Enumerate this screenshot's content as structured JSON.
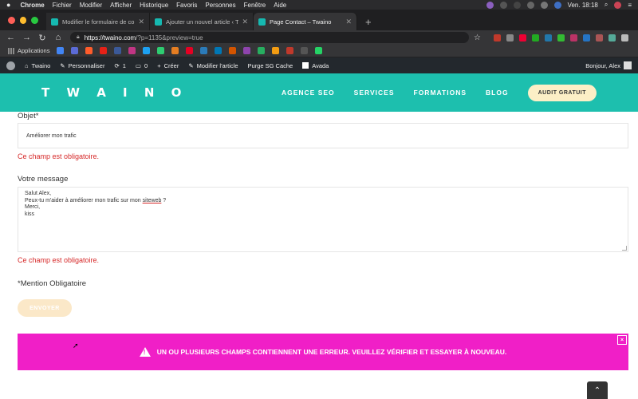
{
  "menubar": {
    "app": "Chrome",
    "menus": [
      "Fichier",
      "Modifier",
      "Afficher",
      "Historique",
      "Favoris",
      "Personnes",
      "Fenêtre",
      "Aide"
    ],
    "datetime": "Ven. 18:18"
  },
  "tabs": [
    {
      "title": "Modifier le formulaire de conta"
    },
    {
      "title": "Ajouter un nouvel article ‹ Twa"
    },
    {
      "title": "Page Contact – Twaino"
    }
  ],
  "address": {
    "host": "https://twaino.com",
    "path": "/?p=1135&preview=true"
  },
  "bookmarks": {
    "apps_label": "Applications"
  },
  "wpbar": {
    "site": "Twaino",
    "customize": "Personnaliser",
    "updates": "1",
    "comments": "0",
    "new": "Créer",
    "edit": "Modifier l'article",
    "purge": "Purge SG Cache",
    "avada": "Avada",
    "greeting": "Bonjour, Alex"
  },
  "header": {
    "logo": "T W A I N O",
    "nav": [
      "AGENCE SEO",
      "SERVICES",
      "FORMATIONS",
      "BLOG"
    ],
    "cta": "AUDIT GRATUIT"
  },
  "form": {
    "subject_label": "Objet*",
    "subject_value": "Améliorer mon trafic",
    "subject_error": "Ce champ est obligatoire.",
    "message_label": "Votre message",
    "message_lines": {
      "l1": "Salut Alex,",
      "l2a": "Peux-tu m'aider à améliorer mon trafic sur mon ",
      "l2b": "siteweb",
      "l2c": " ?",
      "l3": "Merci,",
      "l4": "kiss"
    },
    "message_error": "Ce champ est obligatoire.",
    "mandatory_note": "*Mention Obligatoire",
    "submit": "ENVOYER"
  },
  "alert": {
    "message": "UN OU PLUSIEURS CHAMPS CONTIENNENT UNE ERREUR. VEUILLEZ VÉRIFIER ET ESSAYER À NOUVEAU.",
    "close": "×"
  },
  "colors": {
    "brand": "#1dbfae",
    "alert": "#f01fc7",
    "error": "#d62828",
    "cta": "#fcefc6"
  }
}
